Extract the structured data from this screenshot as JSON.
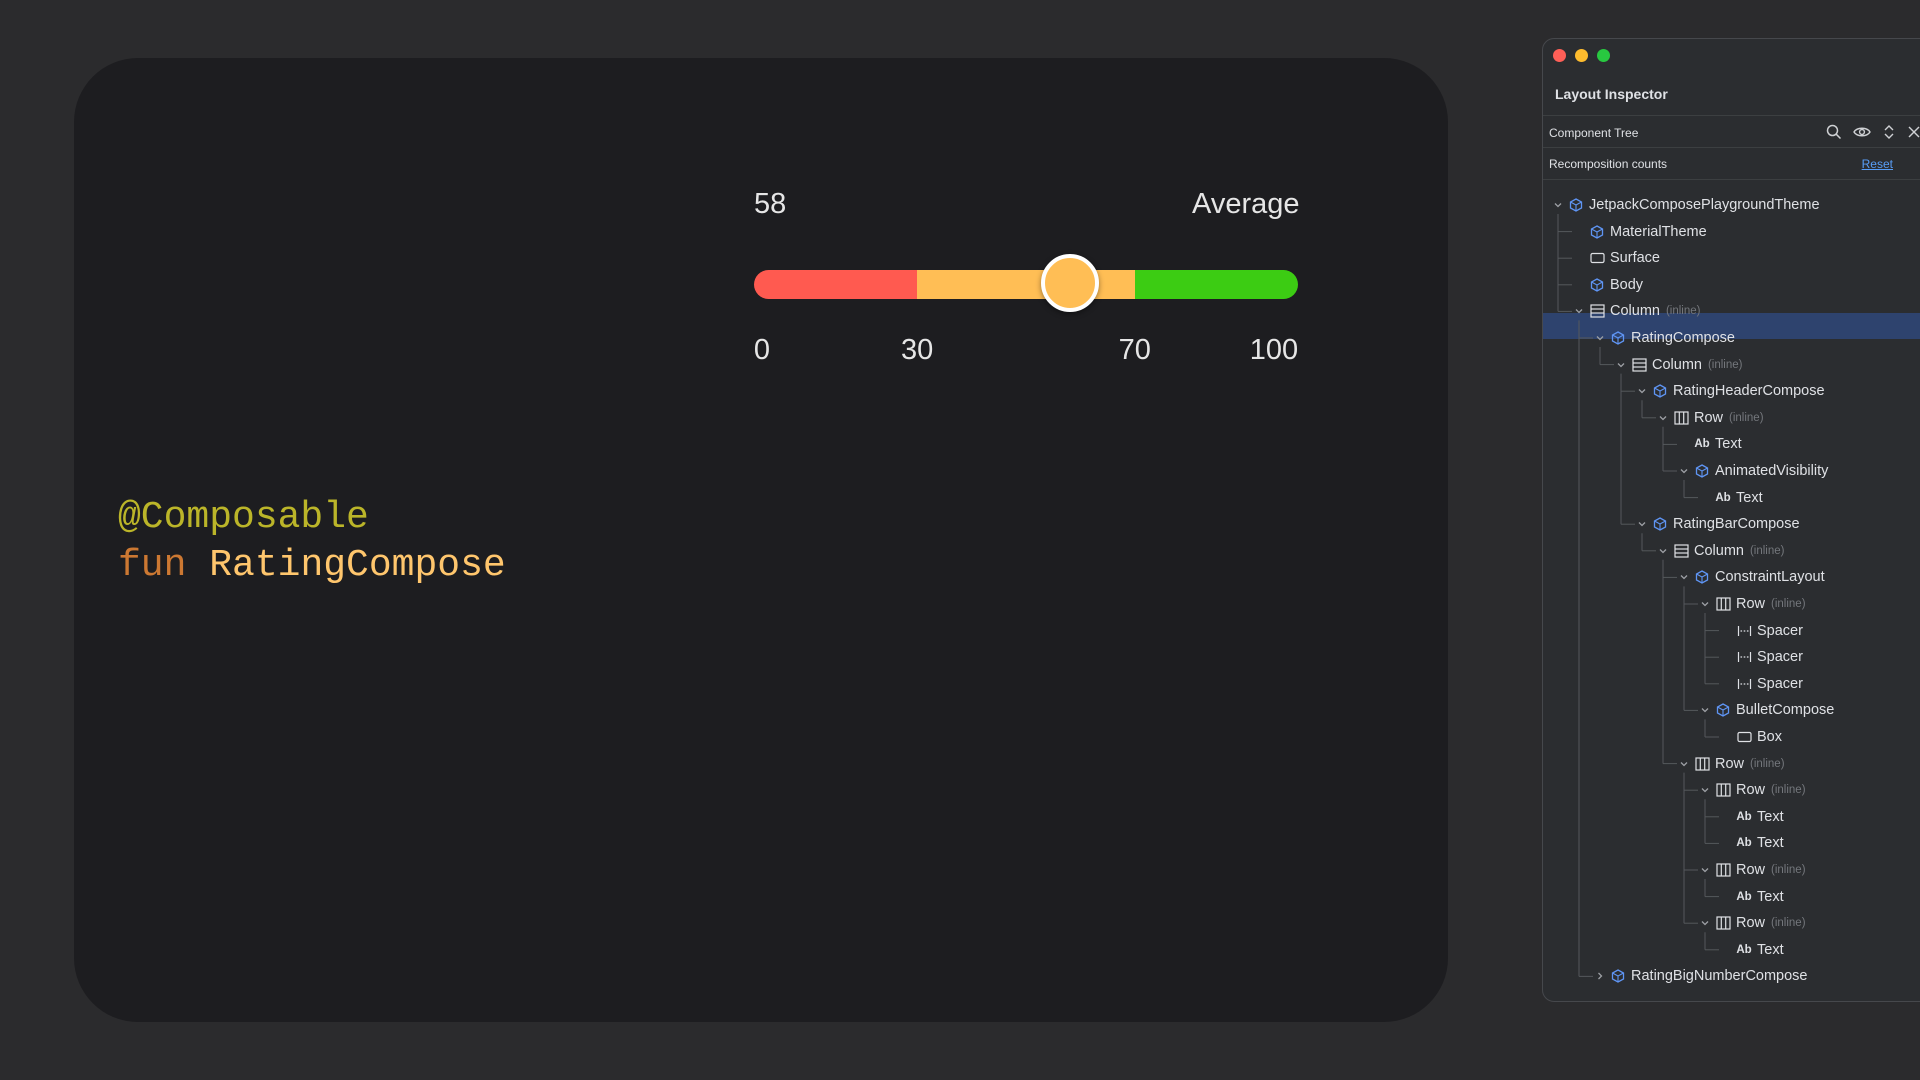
{
  "rating": {
    "value": "58",
    "value_fraction": 0.58,
    "label": "Average",
    "ticks": [
      "0",
      "30",
      "70",
      "100"
    ],
    "tick_values": [
      0,
      30,
      70,
      100
    ],
    "colors": {
      "low": "#ff5a50",
      "mid": "#ffbe55",
      "high": "#3ccc13",
      "knob": "#ffbe55"
    }
  },
  "code": {
    "annotation": "@Composable",
    "keyword": "fun",
    "function_name": "RatingCompose"
  },
  "inspector": {
    "title": "Layout Inspector",
    "panel": "Component Tree",
    "recomposition_label": "Recomposition counts",
    "reset_label": "Reset",
    "tools": [
      "search-icon",
      "eye-icon",
      "expand-collapse-icon",
      "close-icon"
    ],
    "tree": [
      {
        "depth": 0,
        "expanded": true,
        "icon": "composable",
        "label": "JetpackComposePlaygroundTheme"
      },
      {
        "depth": 1,
        "icon": "composable",
        "label": "MaterialTheme"
      },
      {
        "depth": 1,
        "icon": "box",
        "label": "Surface"
      },
      {
        "depth": 1,
        "icon": "composable",
        "label": "Body"
      },
      {
        "depth": 1,
        "expanded": true,
        "icon": "column",
        "label": "Column",
        "tag": "(inline)"
      },
      {
        "depth": 2,
        "expanded": true,
        "icon": "composable",
        "label": "RatingCompose",
        "selected": true
      },
      {
        "depth": 3,
        "expanded": true,
        "icon": "column",
        "label": "Column",
        "tag": "(inline)"
      },
      {
        "depth": 4,
        "expanded": true,
        "icon": "composable",
        "label": "RatingHeaderCompose"
      },
      {
        "depth": 5,
        "expanded": true,
        "icon": "row",
        "label": "Row",
        "tag": "(inline)"
      },
      {
        "depth": 6,
        "icon": "text",
        "label": "Text"
      },
      {
        "depth": 6,
        "expanded": true,
        "icon": "composable",
        "label": "AnimatedVisibility"
      },
      {
        "depth": 7,
        "icon": "text",
        "label": "Text"
      },
      {
        "depth": 4,
        "expanded": true,
        "icon": "composable",
        "label": "RatingBarCompose"
      },
      {
        "depth": 5,
        "expanded": true,
        "icon": "column",
        "label": "Column",
        "tag": "(inline)"
      },
      {
        "depth": 6,
        "expanded": true,
        "icon": "composable",
        "label": "ConstraintLayout"
      },
      {
        "depth": 7,
        "expanded": true,
        "icon": "row",
        "label": "Row",
        "tag": "(inline)"
      },
      {
        "depth": 8,
        "icon": "spacer",
        "label": "Spacer"
      },
      {
        "depth": 8,
        "icon": "spacer",
        "label": "Spacer"
      },
      {
        "depth": 8,
        "icon": "spacer",
        "label": "Spacer"
      },
      {
        "depth": 7,
        "expanded": true,
        "icon": "composable",
        "label": "BulletCompose"
      },
      {
        "depth": 8,
        "icon": "box",
        "label": "Box"
      },
      {
        "depth": 6,
        "expanded": true,
        "icon": "row",
        "label": "Row",
        "tag": "(inline)"
      },
      {
        "depth": 7,
        "expanded": true,
        "icon": "row",
        "label": "Row",
        "tag": "(inline)"
      },
      {
        "depth": 8,
        "icon": "text",
        "label": "Text"
      },
      {
        "depth": 8,
        "icon": "text",
        "label": "Text"
      },
      {
        "depth": 7,
        "expanded": true,
        "icon": "row",
        "label": "Row",
        "tag": "(inline)"
      },
      {
        "depth": 8,
        "icon": "text",
        "label": "Text"
      },
      {
        "depth": 7,
        "expanded": true,
        "icon": "row",
        "label": "Row",
        "tag": "(inline)"
      },
      {
        "depth": 8,
        "icon": "text",
        "label": "Text"
      },
      {
        "depth": 2,
        "expanded": false,
        "icon": "composable",
        "label": "RatingBigNumberCompose"
      }
    ]
  }
}
